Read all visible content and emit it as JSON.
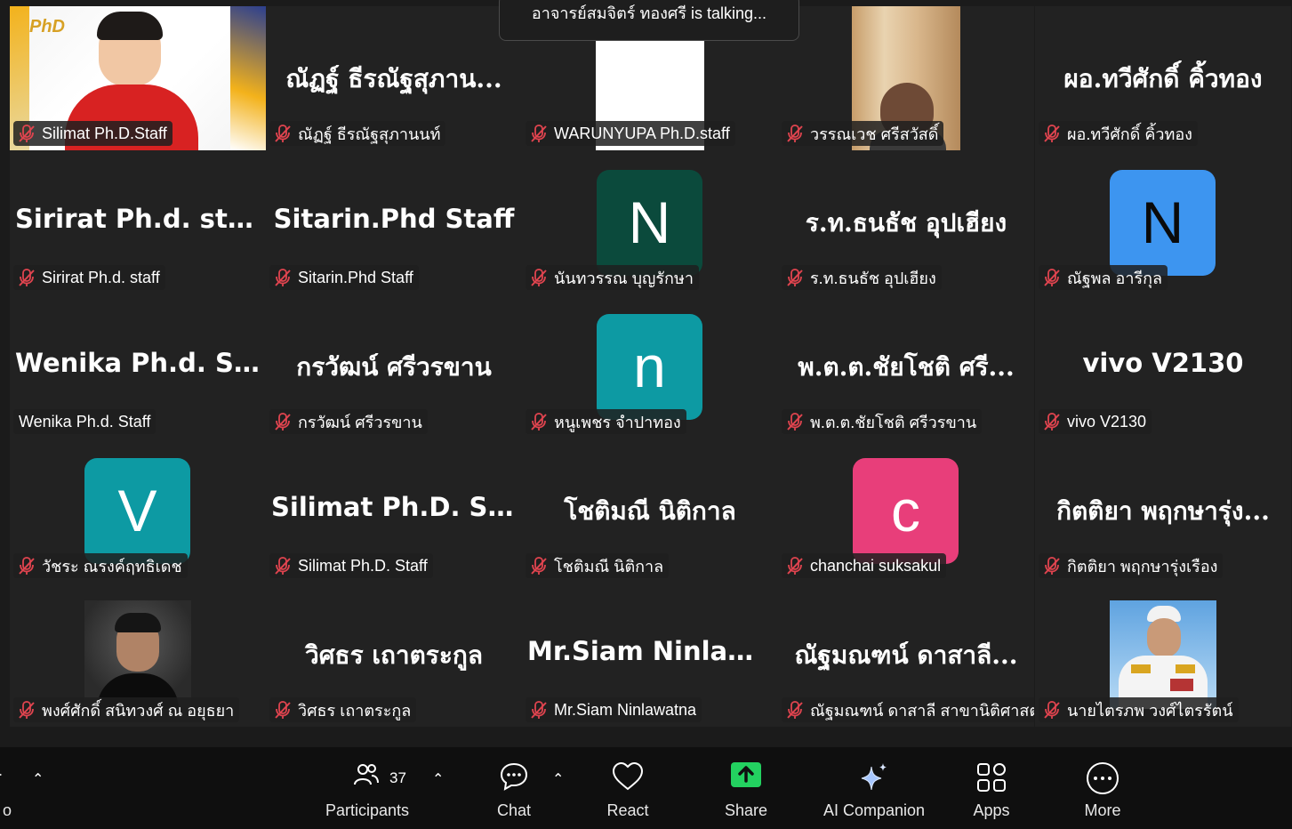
{
  "talking_banner": "อาจารย์สมจิตร์  ทองศรี is talking...",
  "tiles": [
    {
      "row": 0,
      "col": 0,
      "kind": "video",
      "display": "",
      "label": "Silimat Ph.D.Staff",
      "muted": true
    },
    {
      "row": 0,
      "col": 1,
      "kind": "name",
      "display": "ณัฏฐ์ ธีรณัฐสุภาน...",
      "label": "ณัฏฐ์ ธีรณัฐสุภานนท์",
      "muted": true
    },
    {
      "row": 0,
      "col": 2,
      "kind": "video",
      "display": "",
      "label": "WARUNYUPA Ph.D.staff",
      "muted": true
    },
    {
      "row": 0,
      "col": 3,
      "kind": "video",
      "display": "",
      "label": "วรรณเวช ศรีสวัสดิ์",
      "muted": true
    },
    {
      "row": 0,
      "col": 4,
      "kind": "name",
      "display": "ผอ.ทวีศักดิ์  คิ้วทอง",
      "label": "ผอ.ทวีศักดิ์  คิ้วทอง",
      "muted": true
    },
    {
      "row": 1,
      "col": 0,
      "kind": "name",
      "display": "Sirirat Ph.d. staff",
      "label": "Sirirat Ph.d. staff",
      "muted": true
    },
    {
      "row": 1,
      "col": 1,
      "kind": "name",
      "display": "Sitarin.Phd Staff",
      "label": "Sitarin.Phd Staff",
      "muted": true
    },
    {
      "row": 1,
      "col": 2,
      "kind": "avatar",
      "display": "N",
      "avatar_color": "#0b4a3c",
      "label": "นันทวรรณ บุญรักษา",
      "muted": true
    },
    {
      "row": 1,
      "col": 3,
      "kind": "name",
      "display": "ร.ท.ธนธัช  อุปเฮียง",
      "label": "ร.ท.ธนธัช  อุปเฮียง",
      "muted": true
    },
    {
      "row": 1,
      "col": 4,
      "kind": "avatar",
      "display": "N",
      "avatar_color": "#3d95f0",
      "avatar_text_color": "#0a0a0a",
      "label": "ณัฐพล อารีกุล",
      "muted": true
    },
    {
      "row": 2,
      "col": 0,
      "kind": "name",
      "display": "Wenika  Ph.d.  St...",
      "label": "Wenika Ph.d. Staff",
      "muted": false
    },
    {
      "row": 2,
      "col": 1,
      "kind": "name",
      "display": "กรวัฒน์ ศรีวรขาน",
      "label": "กรวัฒน์ ศรีวรขาน",
      "muted": true
    },
    {
      "row": 2,
      "col": 2,
      "kind": "avatar",
      "display": "n",
      "avatar_color": "#0d9aa3",
      "label": "หนูเพชร จำปาทอง",
      "muted": true
    },
    {
      "row": 2,
      "col": 3,
      "kind": "name",
      "display": "พ.ต.ต.ชัยโชติ ศรี...",
      "label": "พ.ต.ต.ชัยโชติ ศรีวรขาน",
      "muted": true
    },
    {
      "row": 2,
      "col": 4,
      "kind": "name",
      "display": "vivo V2130",
      "label": "vivo V2130",
      "muted": true
    },
    {
      "row": 3,
      "col": 0,
      "kind": "avatar",
      "display": "V",
      "avatar_color": "#0d9aa3",
      "label": "วัชระ ณรงค์ฤทธิเดช",
      "muted": true
    },
    {
      "row": 3,
      "col": 1,
      "kind": "name",
      "display": "Silimat  Ph.D.  St...",
      "label": "Silimat Ph.D. Staff",
      "muted": true
    },
    {
      "row": 3,
      "col": 2,
      "kind": "name",
      "display": "โชติมณี นิติกาล",
      "label": "โชติมณี นิติกาล",
      "muted": true
    },
    {
      "row": 3,
      "col": 3,
      "kind": "avatar",
      "display": "c",
      "avatar_color": "#e83e7a",
      "label": "chanchai suksakul",
      "muted": true
    },
    {
      "row": 3,
      "col": 4,
      "kind": "name",
      "display": "กิตติยา พฤกษารุ่ง...",
      "label": "กิตติยา พฤกษารุ่งเรือง",
      "muted": true
    },
    {
      "row": 4,
      "col": 0,
      "kind": "photo",
      "display": "",
      "label": "พงศ์ศักดิ์ สนิทวงศ์ ณ อยุธยา",
      "muted": true
    },
    {
      "row": 4,
      "col": 1,
      "kind": "name",
      "display": "วิศธร เถาตระกูล",
      "label": "วิศธร เถาตระกูล",
      "muted": true
    },
    {
      "row": 4,
      "col": 2,
      "kind": "name",
      "display": "Mr.Siam  Ninlaw...",
      "label": "Mr.Siam Ninlawatna",
      "muted": true
    },
    {
      "row": 4,
      "col": 3,
      "kind": "name",
      "display": "ณัฐมณฑน์ ดาสาลี...",
      "label": "ณัฐมณฑน์ ดาสาลี สาขานิติศาสตร์",
      "muted": true
    },
    {
      "row": 4,
      "col": 4,
      "kind": "photo2",
      "display": "",
      "label": "นายไตรภพ วงศ์ไตรรัตน์",
      "muted": true
    }
  ],
  "toolbar": {
    "video_label": "o",
    "participants_label": "Participants",
    "participants_count": "37",
    "chat_label": "Chat",
    "react_label": "React",
    "share_label": "Share",
    "ai_label": "AI Companion",
    "apps_label": "Apps",
    "more_label": "More"
  },
  "colors": {
    "share_green": "#23d160",
    "mute_red": "#e0444f"
  }
}
